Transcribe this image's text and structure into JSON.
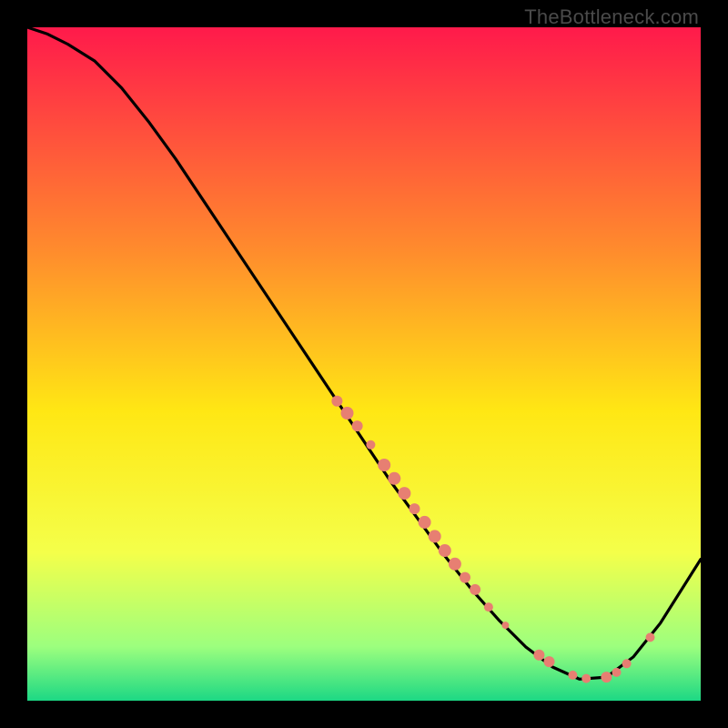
{
  "watermark": "TheBottleneck.com",
  "colors": {
    "dot": "#e77f72",
    "curve": "#000000"
  },
  "chart_data": {
    "type": "line",
    "title": "",
    "xlabel": "",
    "ylabel": "",
    "xlim": [
      0,
      100
    ],
    "ylim": [
      0,
      100
    ],
    "legend": false,
    "grid": false,
    "background_gradient": {
      "top": "#ff1a4b",
      "upper_mid": "#ff8b2d",
      "mid": "#ffe714",
      "lower_mid": "#f4ff4a",
      "low": "#9cff7e",
      "bottom": "#1cd884"
    },
    "series": [
      {
        "name": "bottleneck-curve",
        "x": [
          0,
          3,
          6,
          10,
          14,
          18,
          22,
          26,
          30,
          34,
          38,
          42,
          46,
          50,
          54,
          58,
          62,
          66,
          70,
          74,
          78,
          82,
          86,
          90,
          94,
          100
        ],
        "y": [
          100,
          99,
          97.5,
          95,
          91,
          86,
          80.5,
          74.5,
          68.5,
          62.5,
          56.5,
          50.5,
          44.5,
          38.5,
          32.5,
          27,
          21.5,
          16.5,
          12,
          8,
          5,
          3.2,
          3.5,
          6.5,
          11.5,
          21
        ]
      }
    ],
    "scatter": [
      {
        "name": "highlighted-points",
        "points": [
          {
            "x": 46,
            "y": 44.5,
            "r": 6
          },
          {
            "x": 47.5,
            "y": 42.7,
            "r": 7
          },
          {
            "x": 49,
            "y": 40.8,
            "r": 6
          },
          {
            "x": 51,
            "y": 38.0,
            "r": 5
          },
          {
            "x": 53,
            "y": 35.0,
            "r": 7
          },
          {
            "x": 54.5,
            "y": 33.0,
            "r": 7
          },
          {
            "x": 56,
            "y": 30.8,
            "r": 7
          },
          {
            "x": 57.5,
            "y": 28.5,
            "r": 6
          },
          {
            "x": 59,
            "y": 26.5,
            "r": 7
          },
          {
            "x": 60.5,
            "y": 24.4,
            "r": 7
          },
          {
            "x": 62,
            "y": 22.3,
            "r": 7
          },
          {
            "x": 63.5,
            "y": 20.3,
            "r": 7
          },
          {
            "x": 65,
            "y": 18.3,
            "r": 6
          },
          {
            "x": 66.5,
            "y": 16.5,
            "r": 6
          },
          {
            "x": 68.5,
            "y": 13.9,
            "r": 5
          },
          {
            "x": 71,
            "y": 11.2,
            "r": 4
          },
          {
            "x": 76,
            "y": 6.8,
            "r": 6
          },
          {
            "x": 77.5,
            "y": 5.8,
            "r": 6
          },
          {
            "x": 81,
            "y": 3.8,
            "r": 5
          },
          {
            "x": 83,
            "y": 3.3,
            "r": 5
          },
          {
            "x": 86,
            "y": 3.5,
            "r": 6
          },
          {
            "x": 87.5,
            "y": 4.2,
            "r": 5
          },
          {
            "x": 89,
            "y": 5.5,
            "r": 5
          },
          {
            "x": 92.5,
            "y": 9.4,
            "r": 5
          }
        ]
      }
    ]
  }
}
